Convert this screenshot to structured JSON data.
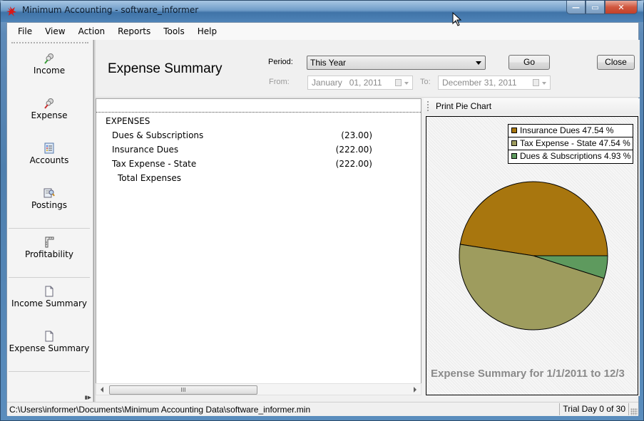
{
  "window": {
    "title": "Minimum Accounting - software_informer",
    "controls": {
      "minimize": "—",
      "maximize": "▭",
      "close": "✕"
    }
  },
  "menu": [
    "File",
    "View",
    "Action",
    "Reports",
    "Tools",
    "Help"
  ],
  "sidebar": {
    "items": [
      {
        "label": "Income",
        "icon": "pushpin-green-icon"
      },
      {
        "label": "Expense",
        "icon": "pushpin-red-icon"
      },
      {
        "label": "Accounts",
        "icon": "list-icon"
      },
      {
        "label": "Postings",
        "icon": "document-search-icon"
      },
      {
        "label": "Profitability",
        "icon": "ruler-icon"
      },
      {
        "label": "Income Summary",
        "icon": "document-icon"
      },
      {
        "label": "Expense Summary",
        "icon": "document-icon"
      }
    ]
  },
  "header": {
    "title": "Expense Summary",
    "period_label": "Period:",
    "period_value": "This Year",
    "go_label": "Go",
    "close_label": "Close",
    "from_label": "From:",
    "from_value": "January   01, 2011",
    "to_label": "To:",
    "to_value": "December 31, 2011"
  },
  "report": {
    "section": "EXPENSES",
    "rows": [
      {
        "name": "Dues & Subscriptions",
        "amount": "(23.00)"
      },
      {
        "name": "Insurance Dues",
        "amount": "(222.00)"
      },
      {
        "name": "Tax Expense - State",
        "amount": "(222.00)"
      }
    ],
    "total_label": "Total Expenses",
    "scroll_thumb": "III"
  },
  "chart_toolbar": {
    "print_label": "Print Pie Chart"
  },
  "chart_data": {
    "type": "pie",
    "title": "Expense Summary for 1/1/2011 to 12/3",
    "legend_position": "top-right",
    "slices": [
      {
        "label": "Insurance Dues",
        "value": 222.0,
        "percent": 47.54,
        "legend": "Insurance Dues 47.54 %",
        "color": "#a8760e"
      },
      {
        "label": "Tax Expense - State",
        "value": 222.0,
        "percent": 47.54,
        "legend": "Tax Expense - State 47.54 %",
        "color": "#9e9c5e"
      },
      {
        "label": "Dues & Subscriptions",
        "value": 23.0,
        "percent": 4.93,
        "legend": "Dues & Subscriptions 4.93 %",
        "color": "#5e9a5e"
      }
    ]
  },
  "status": {
    "path": "C:\\Users\\informer\\Documents\\Minimum Accounting Data\\software_informer.min",
    "trial": "Trial Day 0 of 30"
  }
}
